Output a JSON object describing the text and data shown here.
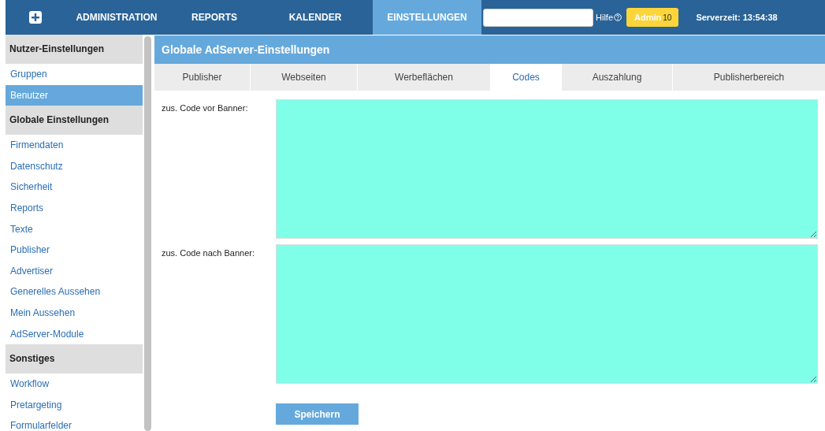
{
  "nav": {
    "items": [
      {
        "label": "ADMINISTRATION",
        "selected": false
      },
      {
        "label": "REPORTS",
        "selected": false
      },
      {
        "label": "KALENDER",
        "selected": false
      },
      {
        "label": "EINSTELLUNGEN",
        "selected": true
      }
    ],
    "help": "Hilfe",
    "user": "Admin",
    "user_count": "10",
    "server_time": "Serverzeit: 13:54:38"
  },
  "sidebar": {
    "sections": [
      {
        "title": "Nutzer-Einstellungen",
        "items": [
          {
            "label": "Gruppen",
            "selected": false
          },
          {
            "label": "Benutzer",
            "selected": true
          }
        ]
      },
      {
        "title": "Globale Einstellungen",
        "items": [
          {
            "label": "Firmendaten",
            "selected": false
          },
          {
            "label": "Datenschutz",
            "selected": false
          },
          {
            "label": "Sicherheit",
            "selected": false
          },
          {
            "label": "Reports",
            "selected": false
          },
          {
            "label": "Texte",
            "selected": false
          },
          {
            "label": "Publisher",
            "selected": false
          },
          {
            "label": "Advertiser",
            "selected": false
          },
          {
            "label": "Generelles Aussehen",
            "selected": false
          },
          {
            "label": "Mein Aussehen",
            "selected": false
          },
          {
            "label": "AdServer-Module",
            "selected": false
          }
        ]
      },
      {
        "title": "Sonstiges",
        "items": [
          {
            "label": "Workflow",
            "selected": false
          },
          {
            "label": "Pretargeting",
            "selected": false
          },
          {
            "label": "Formularfelder",
            "selected": false
          }
        ]
      }
    ]
  },
  "panel": {
    "title": "Globale AdServer-Einstellungen",
    "tabs": [
      {
        "label": "Publisher",
        "selected": false
      },
      {
        "label": "Webseiten",
        "selected": false
      },
      {
        "label": "Werbeflächen",
        "selected": false
      },
      {
        "label": "Codes",
        "selected": true
      },
      {
        "label": "Auszahlung",
        "selected": false
      },
      {
        "label": "Publisherbereich",
        "selected": false
      }
    ],
    "fields": [
      {
        "label": "zus. Code vor Banner:"
      },
      {
        "label": "zus. Code nach Banner:"
      }
    ],
    "save_button": "Speichern"
  }
}
